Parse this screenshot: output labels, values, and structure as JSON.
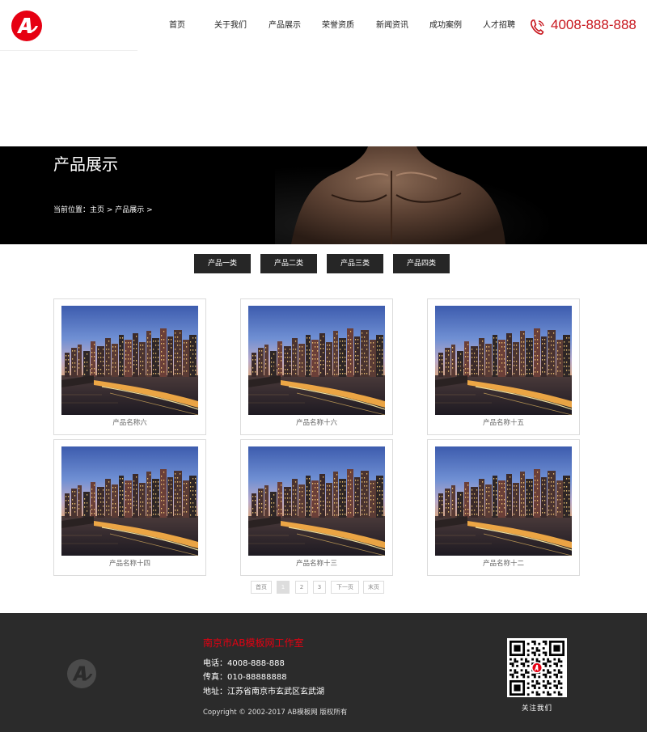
{
  "header": {
    "nav": [
      "首页",
      "关于我们",
      "产品展示",
      "荣誉资质",
      "新闻资讯",
      "成功案例",
      "人才招聘"
    ],
    "phone": "4008-888-888"
  },
  "banner": {
    "title": "产品展示",
    "breadcrumb": "当前位置：主页 > 产品展示 >"
  },
  "categories": [
    "产品一类",
    "产品二类",
    "产品三类",
    "产品四类"
  ],
  "products": [
    {
      "name": "产品名称六"
    },
    {
      "name": "产品名称十六"
    },
    {
      "name": "产品名称十五"
    },
    {
      "name": "产品名称十四"
    },
    {
      "name": "产品名称十三"
    },
    {
      "name": "产品名称十二"
    }
  ],
  "pagination": {
    "first": "首页",
    "pages": [
      "1",
      "2",
      "3"
    ],
    "current": "1",
    "next": "下一页",
    "last": "末页"
  },
  "footer": {
    "company": "南京市AB模板网工作室",
    "phone": "电话：4008-888-888",
    "fax": "传真：010-88888888",
    "address": "地址：江苏省南京市玄武区玄武湖",
    "copyright": "Copyright © 2002-2017 AB模板网 版权所有",
    "qr_label": "关注我们"
  },
  "colors": {
    "brand_red": "#e60012",
    "phone_red": "#c8161d",
    "dark": "#262626",
    "footer_bg": "#2b2b2b"
  },
  "icons": [
    "logo-icon",
    "phone-icon",
    "qr-code"
  ]
}
